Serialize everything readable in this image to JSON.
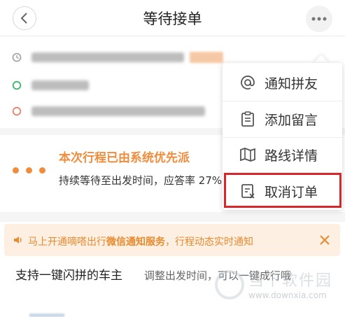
{
  "header": {
    "title": "等待接单",
    "back_icon": "chevron-left-icon",
    "more_icon": "more-dots-icon"
  },
  "trip": {
    "rows": [
      {
        "icon": "clock-icon",
        "color": "#9e9e9e"
      },
      {
        "icon": "start-point-icon",
        "color": "#3bb56b"
      },
      {
        "icon": "end-point-icon",
        "color": "#e9826e"
      }
    ]
  },
  "status": {
    "title": "本次行程已由系统优先派",
    "desc": "持续等待至出发时间，应答率 27%",
    "accent": "#f08d3c"
  },
  "notice": {
    "text_prefix": "马上开通嘀嗒出行",
    "text_bold": "微信通知服务",
    "text_suffix": "，行程动态实时通知",
    "close_icon": "close-icon",
    "color": "#e78a2e"
  },
  "bottom": {
    "title": "支持一键闪拼的车主",
    "desc": "调整出发时间，可以一键成行哦"
  },
  "menu": {
    "items": [
      {
        "label": "通知拼友",
        "icon": "at-icon"
      },
      {
        "label": "添加留言",
        "icon": "clipboard-icon"
      },
      {
        "label": "路线详情",
        "icon": "map-icon"
      },
      {
        "label": "取消订单",
        "icon": "cancel-order-icon"
      }
    ],
    "highlight_color": "#d8262b"
  },
  "watermark": {
    "text": "当下软件园",
    "url": "www.downxia.com"
  }
}
